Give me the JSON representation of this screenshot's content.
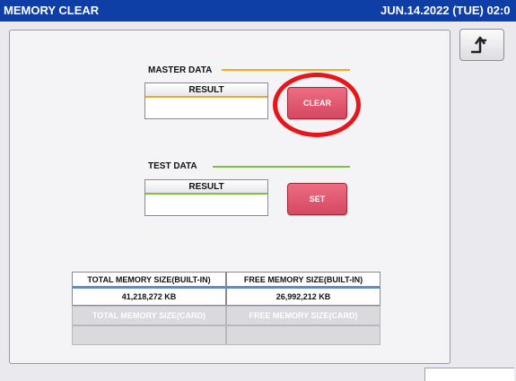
{
  "header": {
    "title": "MEMORY CLEAR",
    "datetime": "JUN.14.2022 (TUE) 02:0"
  },
  "icons": {
    "back": "return-arrow-icon"
  },
  "master_data": {
    "label": "MASTER DATA",
    "line_color": "#f5a623",
    "result_header": "RESULT",
    "result_value": "",
    "button_label": "CLEAR"
  },
  "test_data": {
    "label": "TEST DATA",
    "line_color": "#7cc242",
    "result_header": "RESULT",
    "result_value": "",
    "button_label": "SET"
  },
  "memory": {
    "total_builtin_label": "TOTAL MEMORY SIZE(BUILT-IN)",
    "free_builtin_label": "FREE MEMORY SIZE(BUILT-IN)",
    "total_builtin_value": "41,218,272 KB",
    "free_builtin_value": "26,992,212 KB",
    "total_card_label": "TOTAL MEMORY SIZE(CARD)",
    "free_card_label": "FREE MEMORY SIZE(CARD)"
  },
  "colors": {
    "title_bar": "#0f3fa6",
    "button_red": "#d54861",
    "highlight": "#e8151b"
  }
}
